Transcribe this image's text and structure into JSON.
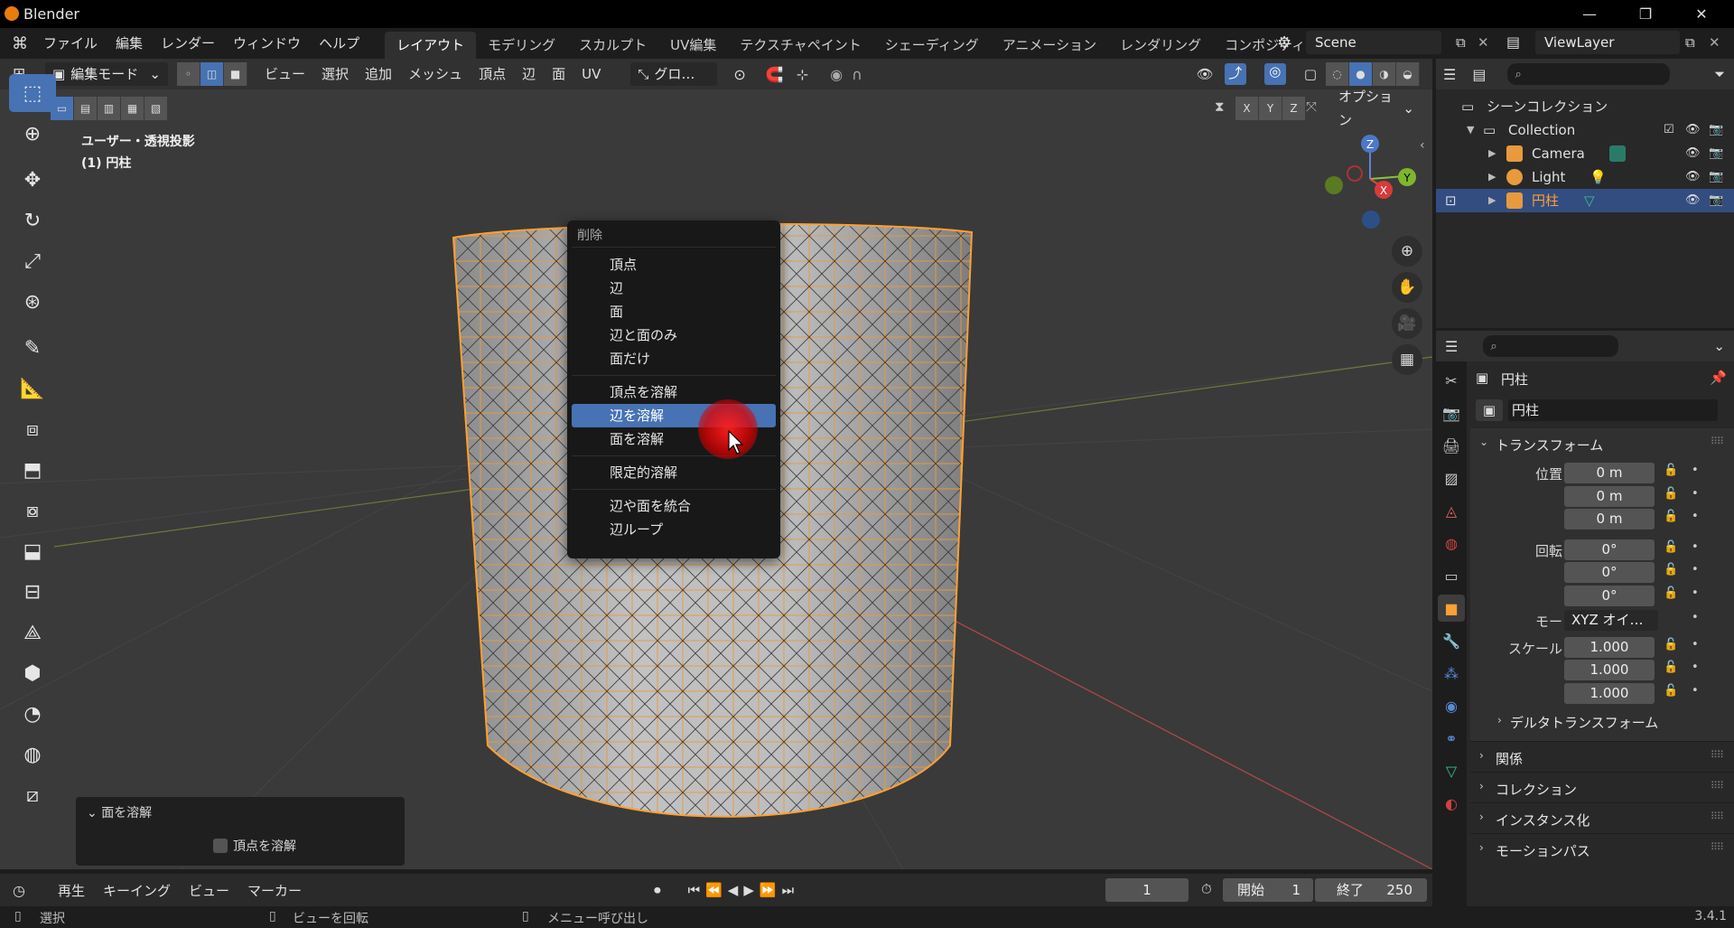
{
  "window": {
    "title": "Blender",
    "minimize": "—",
    "restore": "❐",
    "close": "✕"
  },
  "menus": [
    "ファイル",
    "編集",
    "レンダー",
    "ウィンドウ",
    "ヘルプ"
  ],
  "workspaces": [
    "レイアウト",
    "モデリング",
    "スカルプト",
    "UV編集",
    "テクスチャペイント",
    "シェーディング",
    "アニメーション",
    "レンダリング",
    "コンポジティン:"
  ],
  "active_workspace": "レイアウト",
  "scene": {
    "name": "Scene",
    "view_layer": "ViewLayer"
  },
  "viewport": {
    "mode": "編集モード",
    "header_menus": [
      "ビュー",
      "選択",
      "追加",
      "メッシュ",
      "頂点",
      "辺",
      "面",
      "UV"
    ],
    "orientation": "グロ…",
    "axes": [
      "X",
      "Y",
      "Z"
    ],
    "options_label": "オプション",
    "view_name": "ユーザー・透視投影",
    "object_info": "(1) 円柱",
    "gizmo_axes": {
      "x": "X",
      "y": "Y",
      "z": "Z"
    }
  },
  "context_menu": {
    "title": "削除",
    "groups": [
      [
        "頂点",
        "辺",
        "面",
        "辺と面のみ",
        "面だけ"
      ],
      [
        "頂点を溶解",
        "辺を溶解",
        "面を溶解"
      ],
      [
        "限定的溶解"
      ],
      [
        "辺や面を統合",
        "辺ループ"
      ]
    ],
    "highlighted": "辺を溶解"
  },
  "last_operation": {
    "title": "面を溶解",
    "option_label": "頂点を溶解",
    "option_checked": false
  },
  "timeline": {
    "menus": [
      "再生",
      "キーイング",
      "ビュー",
      "マーカー"
    ],
    "current_frame": "1",
    "start_label": "開始",
    "start_value": "1",
    "end_label": "終了",
    "end_value": "250"
  },
  "status_bar": {
    "select": "選択",
    "rotate_view": "ビューを回転",
    "call_menu": "メニュー呼び出し",
    "version": "3.4.1"
  },
  "outliner": {
    "root": "シーンコレクション",
    "collection": "Collection",
    "items": [
      {
        "name": "Camera",
        "color": "#e89a3c"
      },
      {
        "name": "Light",
        "color": "#e89a3c"
      },
      {
        "name": "円柱",
        "color": "#e89a3c",
        "selected": true
      }
    ]
  },
  "properties": {
    "object_name": "円柱",
    "data_name": "円柱",
    "transform_title": "トランスフォーム",
    "location": {
      "label": "位置 X",
      "x": "0 m",
      "y": "0 m",
      "z": "0 m"
    },
    "rotation": {
      "label": "回転 X",
      "x": "0°",
      "y": "0°",
      "z": "0°"
    },
    "mode": {
      "label": "モード",
      "value": "XYZ オイ…"
    },
    "scale": {
      "label": "スケール X",
      "x": "1.000",
      "y": "1.000",
      "z": "1.000"
    },
    "axis_y": "Y",
    "axis_z": "Z",
    "sections": [
      "デルタトランスフォーム",
      "関係",
      "コレクション",
      "インスタンス化",
      "モーションパス"
    ]
  },
  "colors": {
    "accent": "#4772b3",
    "select_orange": "#ffa033",
    "viewport_bg": "#3a3a3a"
  }
}
